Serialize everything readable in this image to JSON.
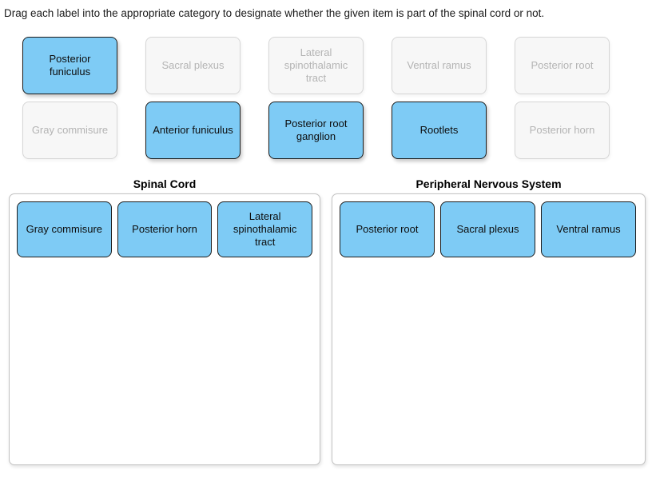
{
  "instruction": "Drag each label into the appropriate category to designate whether the given item is part of the spinal cord or not.",
  "colors": {
    "tile_active_fill": "#7ecbf5",
    "tile_active_border": "#1c1c1c",
    "tile_used_fill": "#f7f7f7",
    "tile_used_border": "#d6d6d6",
    "tile_used_text": "#b4b4b4",
    "zone_border": "#c2c2c2",
    "page_background": "#ffffff",
    "text": "#000000"
  },
  "tile_bank": {
    "rows": [
      [
        {
          "label": "Posterior funiculus",
          "state": "active"
        },
        {
          "label": "Sacral plexus",
          "state": "used"
        },
        {
          "label": "Lateral spinothalamic tract",
          "state": "used"
        },
        {
          "label": "Ventral ramus",
          "state": "used"
        },
        {
          "label": "Posterior root",
          "state": "used"
        }
      ],
      [
        {
          "label": "Gray commisure",
          "state": "used"
        },
        {
          "label": "Anterior funiculus",
          "state": "active"
        },
        {
          "label": "Posterior root ganglion",
          "state": "active"
        },
        {
          "label": "Rootlets",
          "state": "active"
        },
        {
          "label": "Posterior horn",
          "state": "used"
        }
      ]
    ]
  },
  "zones": [
    {
      "title": "Spinal Cord",
      "items": [
        {
          "label": "Gray commisure"
        },
        {
          "label": "Posterior horn"
        },
        {
          "label": "Lateral spinothalamic tract"
        }
      ]
    },
    {
      "title": "Peripheral Nervous System",
      "items": [
        {
          "label": "Posterior root"
        },
        {
          "label": "Sacral plexus"
        },
        {
          "label": "Ventral ramus"
        }
      ]
    }
  ]
}
